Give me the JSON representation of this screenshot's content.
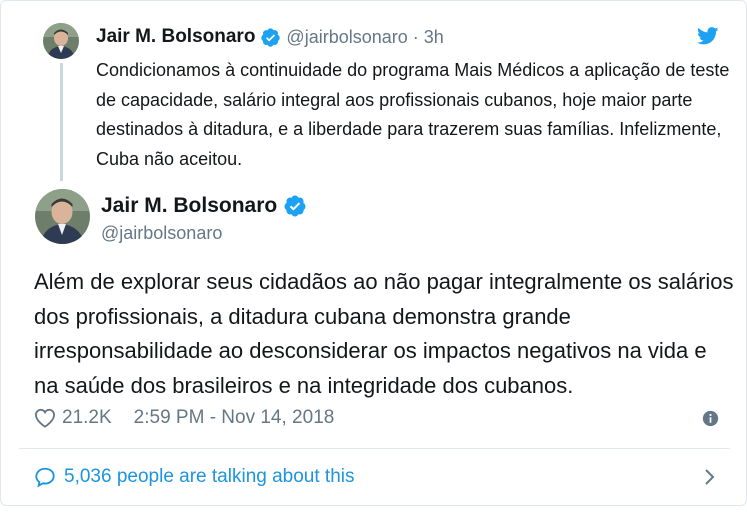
{
  "parent": {
    "name": "Jair M. Bolsonaro",
    "handle": "@jairbolsonaro · 3h",
    "text": "Condicionamos à continuidade do programa Mais Médicos a aplicação de teste de capacidade, salário integral aos profissionais cubanos, hoje maior parte destinados à ditadura, e a liberdade para trazerem suas famílias. Infelizmente, Cuba não aceitou."
  },
  "tweet": {
    "name": "Jair M. Bolsonaro",
    "handle": "@jairbolsonaro",
    "text": "Além de explorar seus cidadãos ao não pagar integralmente os salários dos profissionais, a ditadura cubana demonstra grande irresponsabilidade ao desconsiderar os impactos negativos na vida e na saúde dos brasileiros e na integridade dos cubanos.",
    "likes": "21.2K",
    "timestamp": "2:59 PM - Nov 14, 2018"
  },
  "footer": {
    "talking": "5,036 people are talking about this"
  },
  "colors": {
    "accent": "#1da1f2",
    "link": "#1b95e0",
    "muted": "#657786",
    "text": "#14171a"
  },
  "icons": {
    "verified": "verified-badge-icon",
    "brand": "twitter-bird-icon",
    "like": "heart-icon",
    "info": "info-icon",
    "talk": "speech-bubble-icon",
    "more": "chevron-right-icon"
  }
}
